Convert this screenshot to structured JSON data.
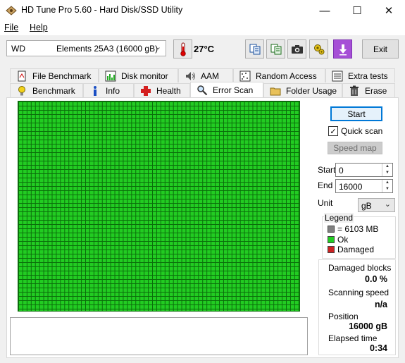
{
  "window": {
    "title": "HD Tune Pro 5.60 - Hard Disk/SSD Utility",
    "minimize": "—",
    "maximize": "☐",
    "close": "✕"
  },
  "menu": {
    "file": "File",
    "help": "Help"
  },
  "toolbar": {
    "drive_vendor": "WD",
    "drive_model": "Elements 25A3 (16000 gB)",
    "temperature": "27°C",
    "exit_label": "Exit",
    "icons": [
      "thermometer-icon",
      "copy-info-icon",
      "copy-text-icon",
      "camera-icon",
      "options-icon",
      "save-icon"
    ]
  },
  "tabs_row1": [
    {
      "label": "File Benchmark",
      "icon": "file-benchmark-icon"
    },
    {
      "label": "Disk monitor",
      "icon": "disk-monitor-icon"
    },
    {
      "label": "AAM",
      "icon": "speaker-icon"
    },
    {
      "label": "Random Access",
      "icon": "random-access-icon"
    },
    {
      "label": "Extra tests",
      "icon": "extra-tests-icon"
    }
  ],
  "tabs_row2": [
    {
      "label": "Benchmark",
      "icon": "lightbulb-icon"
    },
    {
      "label": "Info",
      "icon": "info-icon"
    },
    {
      "label": "Health",
      "icon": "health-cross-icon"
    },
    {
      "label": "Error Scan",
      "icon": "magnifier-icon",
      "active": true
    },
    {
      "label": "Folder Usage",
      "icon": "folder-icon"
    },
    {
      "label": "Erase",
      "icon": "trash-icon"
    }
  ],
  "scan": {
    "start_label": "Start",
    "quick_scan_label": "Quick scan",
    "quick_scan_checked": true,
    "speed_map_label": "Speed map",
    "start_field_label": "Start",
    "start_value": "0",
    "end_field_label": "End",
    "end_value": "16000",
    "unit_label": "Unit",
    "unit_value": "gB"
  },
  "legend": {
    "title": "Legend",
    "block_size": "= 6103 MB",
    "ok": "Ok",
    "damaged": "Damaged",
    "colors": {
      "block": "#808080",
      "ok": "#22cc22",
      "damaged": "#cc2222"
    }
  },
  "stats": {
    "damaged_label": "Damaged blocks",
    "damaged_value": "0.0 %",
    "speed_label": "Scanning speed",
    "speed_value": "n/a",
    "position_label": "Position",
    "position_value": "16000 gB",
    "elapsed_label": "Elapsed time",
    "elapsed_value": "0:34"
  }
}
